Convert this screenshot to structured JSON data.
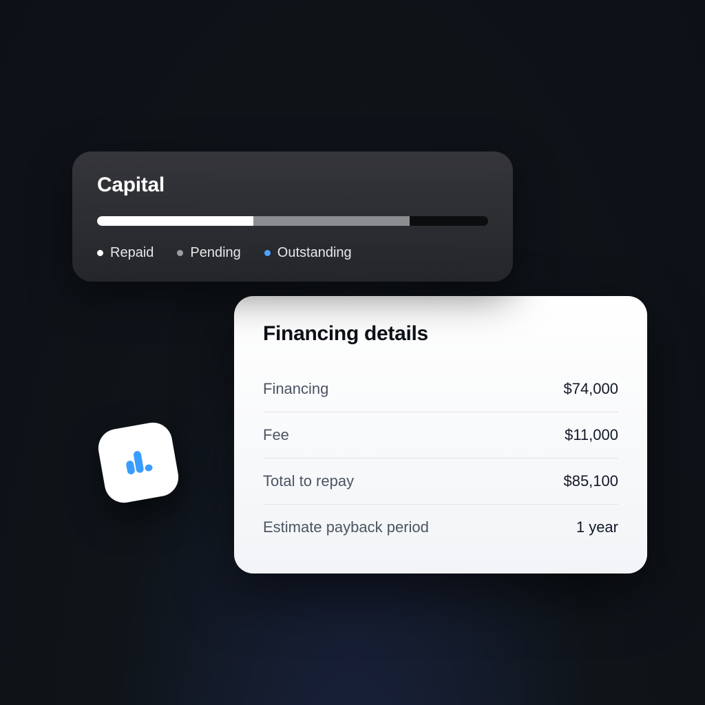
{
  "capital": {
    "title": "Capital",
    "progress": {
      "repaid_pct": 40,
      "pending_pct": 40,
      "outstanding_pct": 20
    },
    "legend": {
      "repaid": "Repaid",
      "pending": "Pending",
      "outstanding": "Outstanding"
    }
  },
  "details": {
    "title": "Financing details",
    "rows": [
      {
        "label": "Financing",
        "value": "$74,000"
      },
      {
        "label": "Fee",
        "value": "$11,000"
      },
      {
        "label": "Total to repay",
        "value": "$85,100"
      },
      {
        "label": "Estimate payback period",
        "value": "1 year"
      }
    ]
  },
  "colors": {
    "accent_blue": "#3b9cff"
  },
  "icon": {
    "name": "bar-chart-icon"
  }
}
